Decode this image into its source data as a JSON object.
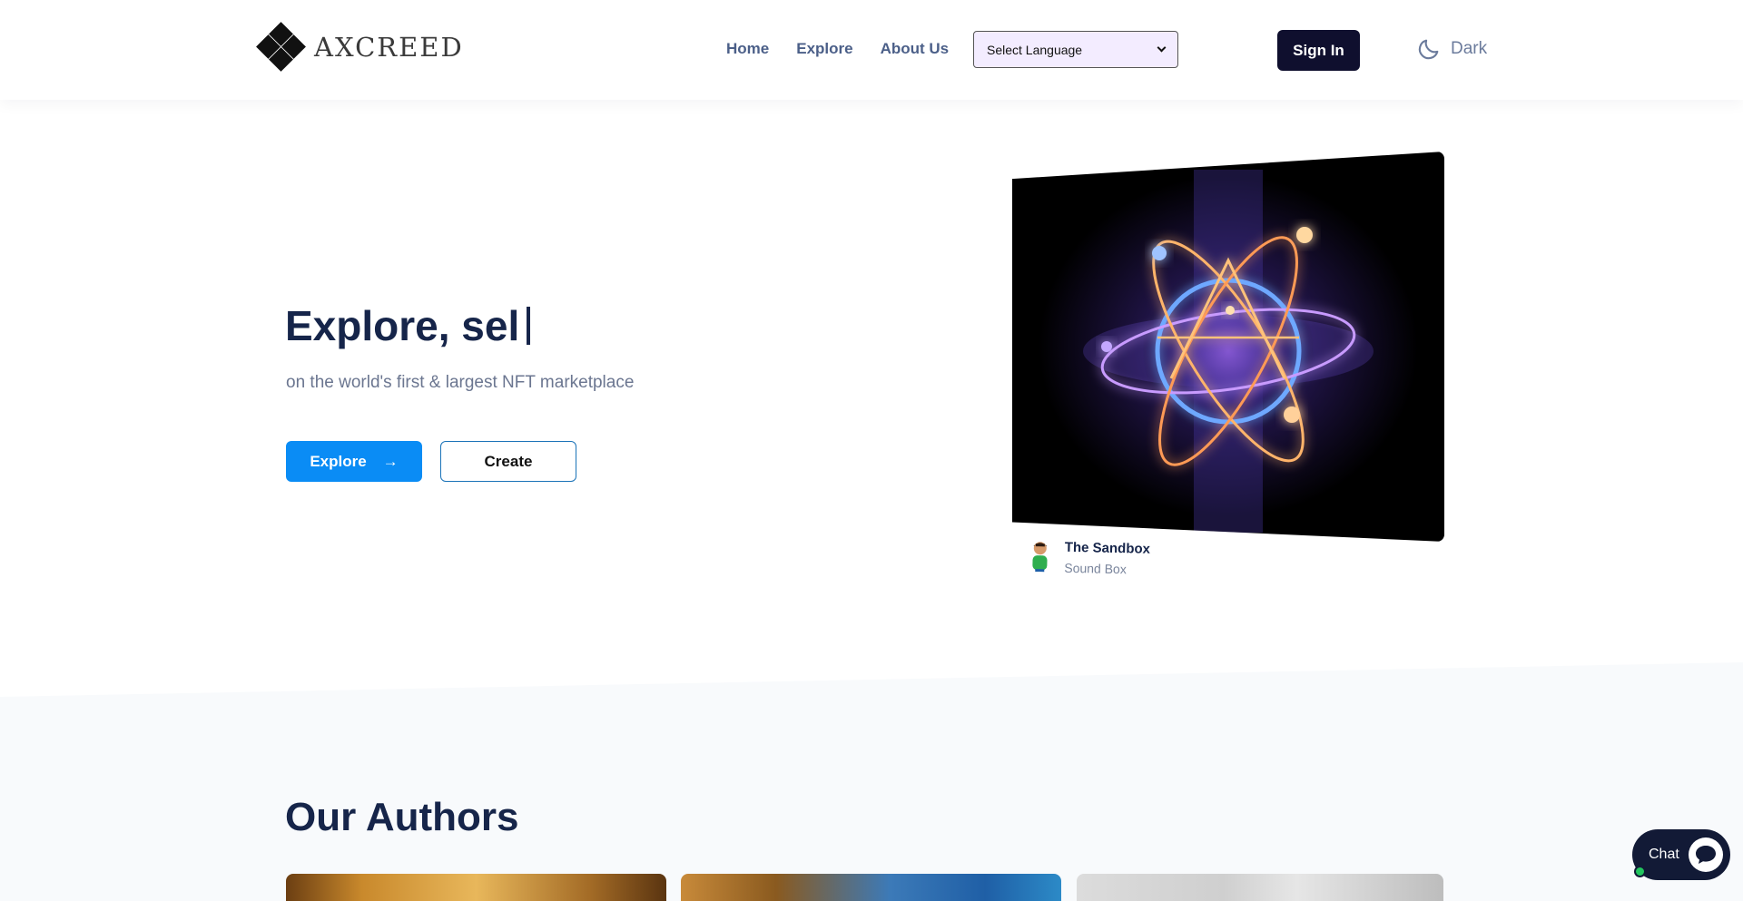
{
  "header": {
    "logo_text": "AXCREED",
    "nav": [
      "Home",
      "Explore",
      "About Us"
    ],
    "language_select": "Select Language",
    "signin_label": "Sign In",
    "theme_label": "Dark"
  },
  "hero": {
    "title": "Explore, sel",
    "subtitle": "on the world's first & largest NFT marketplace",
    "explore_label": "Explore",
    "create_label": "Create"
  },
  "nft_card": {
    "author": "The Sandbox",
    "collection": "Sound Box"
  },
  "authors": {
    "title": "Our Authors"
  },
  "chat": {
    "label": "Chat"
  },
  "icons": {
    "logo": "diamond-logo-icon",
    "theme": "moon-icon",
    "arrow": "arrow-right-icon",
    "chat": "chat-bubble-icon"
  },
  "colors": {
    "primary": "#0a8cf5",
    "heading": "#16254a",
    "nav": "#4b5f88",
    "signin_bg": "#0f0f2e",
    "chat_bg": "#121a36"
  }
}
